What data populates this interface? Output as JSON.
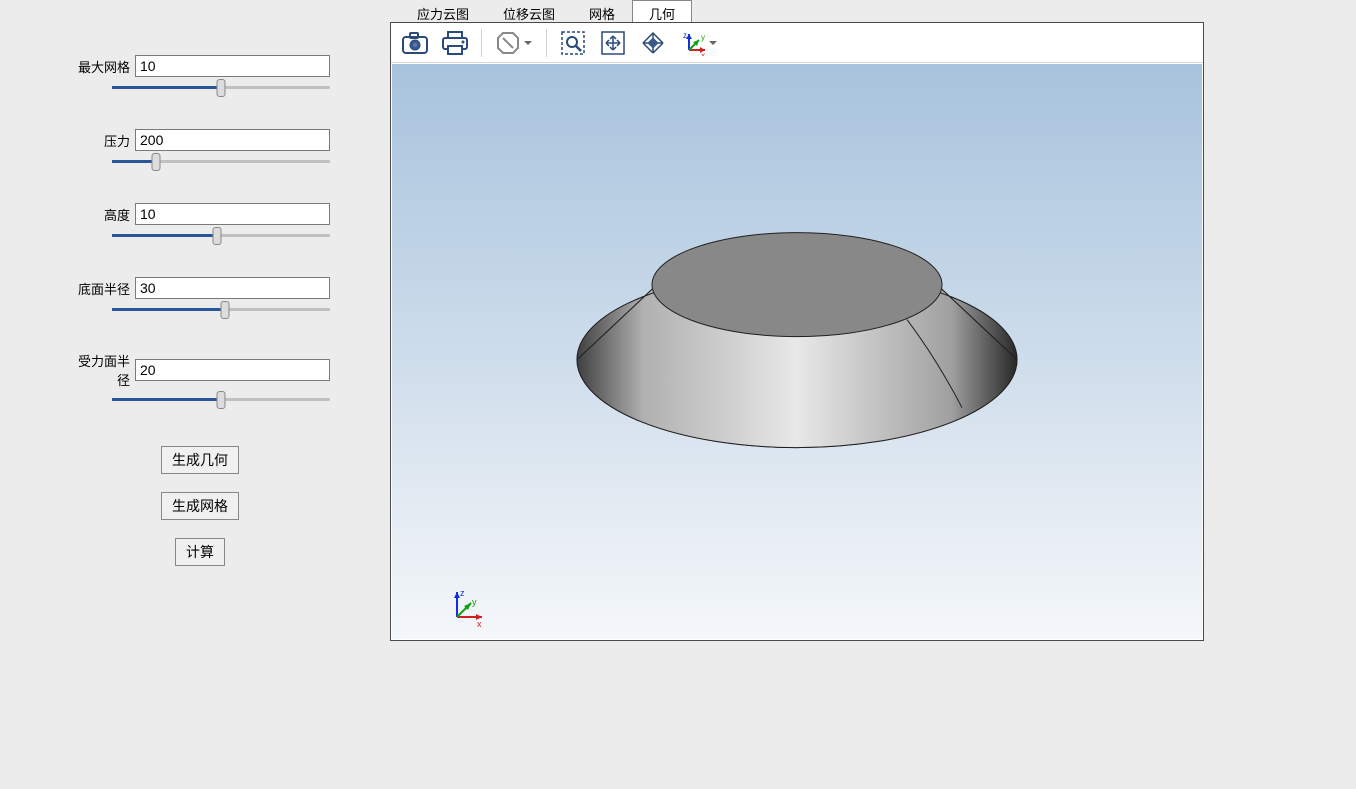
{
  "sidebar": {
    "fields": [
      {
        "label": "最大网格",
        "value": "10",
        "fill": 50
      },
      {
        "label": "压力",
        "value": "200",
        "fill": 20
      },
      {
        "label": "高度",
        "value": "10",
        "fill": 48
      },
      {
        "label": "底面半径",
        "value": "30",
        "fill": 52
      },
      {
        "label": "受力面半径",
        "value": "20",
        "fill": 50
      }
    ],
    "buttons": {
      "gen_geom": "生成几何",
      "gen_mesh": "生成网格",
      "compute": "计算"
    }
  },
  "tabs": {
    "items": [
      "应力云图",
      "位移云图",
      "网格",
      "几何"
    ],
    "active": 3
  },
  "toolbar": {
    "camera": "camera-icon",
    "print": "print-icon",
    "reset": "stop-icon",
    "zoom_box": "zoom-box-icon",
    "fit": "fit-icon",
    "pan": "pan-icon",
    "rotate": "rotate-icon"
  },
  "triad": {
    "x": "x",
    "y": "y",
    "z": "z"
  }
}
